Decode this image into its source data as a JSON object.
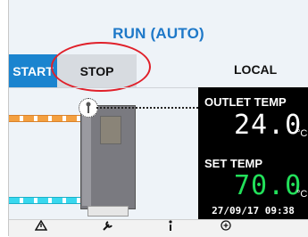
{
  "header": {
    "status": "RUN (AUTO)"
  },
  "controls": {
    "start_label": "START",
    "stop_label": "STOP",
    "mode_label": "LOCAL"
  },
  "panel": {
    "outlet_label": "OUTLET TEMP",
    "outlet_value": "24.0",
    "outlet_unit": "°C",
    "set_label": "SET TEMP",
    "set_value": "70.0",
    "set_unit": "°C",
    "datetime": "27/09/17  09:38"
  },
  "toolbar": {
    "icons": [
      "warning-icon",
      "wrench-icon",
      "info-icon",
      "zoom-in-icon"
    ]
  },
  "colors": {
    "accent_blue": "#1b84cf",
    "title_blue": "#1e78c8",
    "outlet_value": "#ffffff",
    "set_value": "#22e05a",
    "highlight": "#e0202a"
  }
}
